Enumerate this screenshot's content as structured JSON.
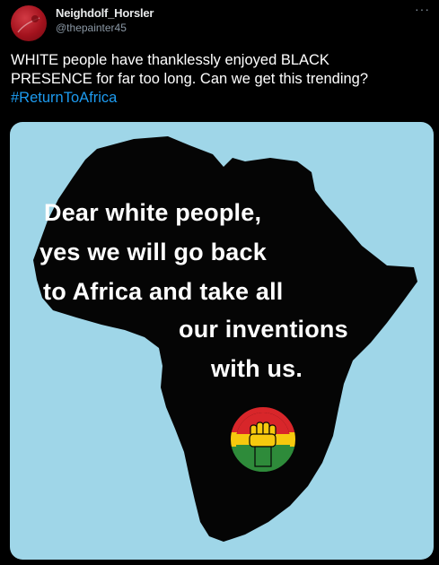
{
  "author": {
    "display_name": "Neighdolf_Horsler",
    "handle": "@thepainter45"
  },
  "more_label": "···",
  "tweet": {
    "text_line1": "WHITE people have thanklessly enjoyed BLACK",
    "text_line2": "PRESENCE for far too long. Can we get this trending?",
    "hashtag": "#ReturnToAfrica"
  },
  "media": {
    "background_color": "#9fd6e8",
    "continent_color": "#050505",
    "lines": [
      "Dear white people,",
      "yes we will go back",
      "to Africa and take all",
      "our inventions",
      "with us."
    ],
    "emblem_colors": [
      "#d8262a",
      "#f6c90e",
      "#2e8b3a"
    ],
    "emblem_icon": "raised-fist-icon"
  },
  "colors": {
    "background": "#000000",
    "text": "#e7e9ea",
    "secondary": "#8b98a5",
    "link": "#1d9bf0"
  }
}
